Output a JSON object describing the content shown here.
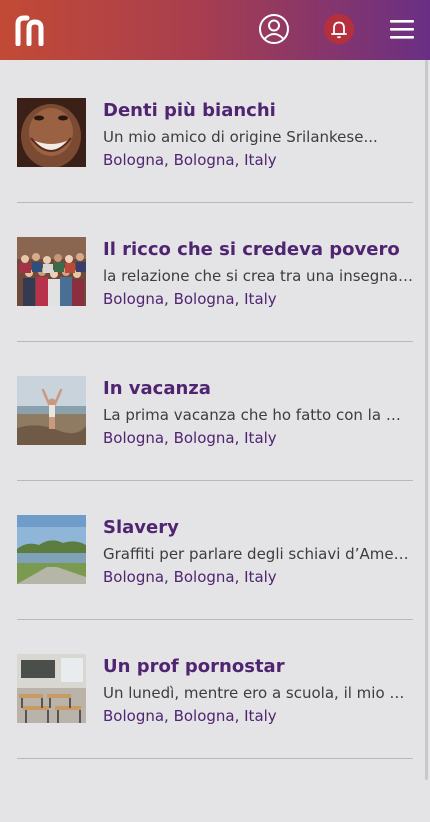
{
  "header": {
    "logo_icon": "rn-logo",
    "user_icon": "user-circle-icon",
    "bell_icon": "bell-icon",
    "menu_icon": "hamburger-icon"
  },
  "stories": [
    {
      "title": "Denti più bianchi",
      "excerpt": "Un mio amico di origine Srilankese...",
      "location": "Bologna, Bologna, Italy",
      "thumbnail": "smiling-face-photo"
    },
    {
      "title": "Il ricco che si credeva povero",
      "excerpt": "la relazione che si crea tra una insegnante...",
      "location": "Bologna, Bologna, Italy",
      "thumbnail": "group-photo"
    },
    {
      "title": "In vacanza",
      "excerpt": "La prima vacanza che ho fatto con la mia...",
      "location": "Bologna, Bologna, Italy",
      "thumbnail": "beach-photo"
    },
    {
      "title": "Slavery",
      "excerpt": "Graffiti per parlare degli schiavi d’America",
      "location": "Bologna, Bologna, Italy",
      "thumbnail": "riverside-photo"
    },
    {
      "title": "Un prof pornostar",
      "excerpt": "Un lunedì, mentre ero a scuola, il mio Prof...",
      "location": "Bologna, Bologna, Italy",
      "thumbnail": "classroom-photo"
    }
  ],
  "colors": {
    "header_start": "#c24a35",
    "header_end": "#6a2f84",
    "title": "#4f2572",
    "background": "#e4e3e5"
  }
}
